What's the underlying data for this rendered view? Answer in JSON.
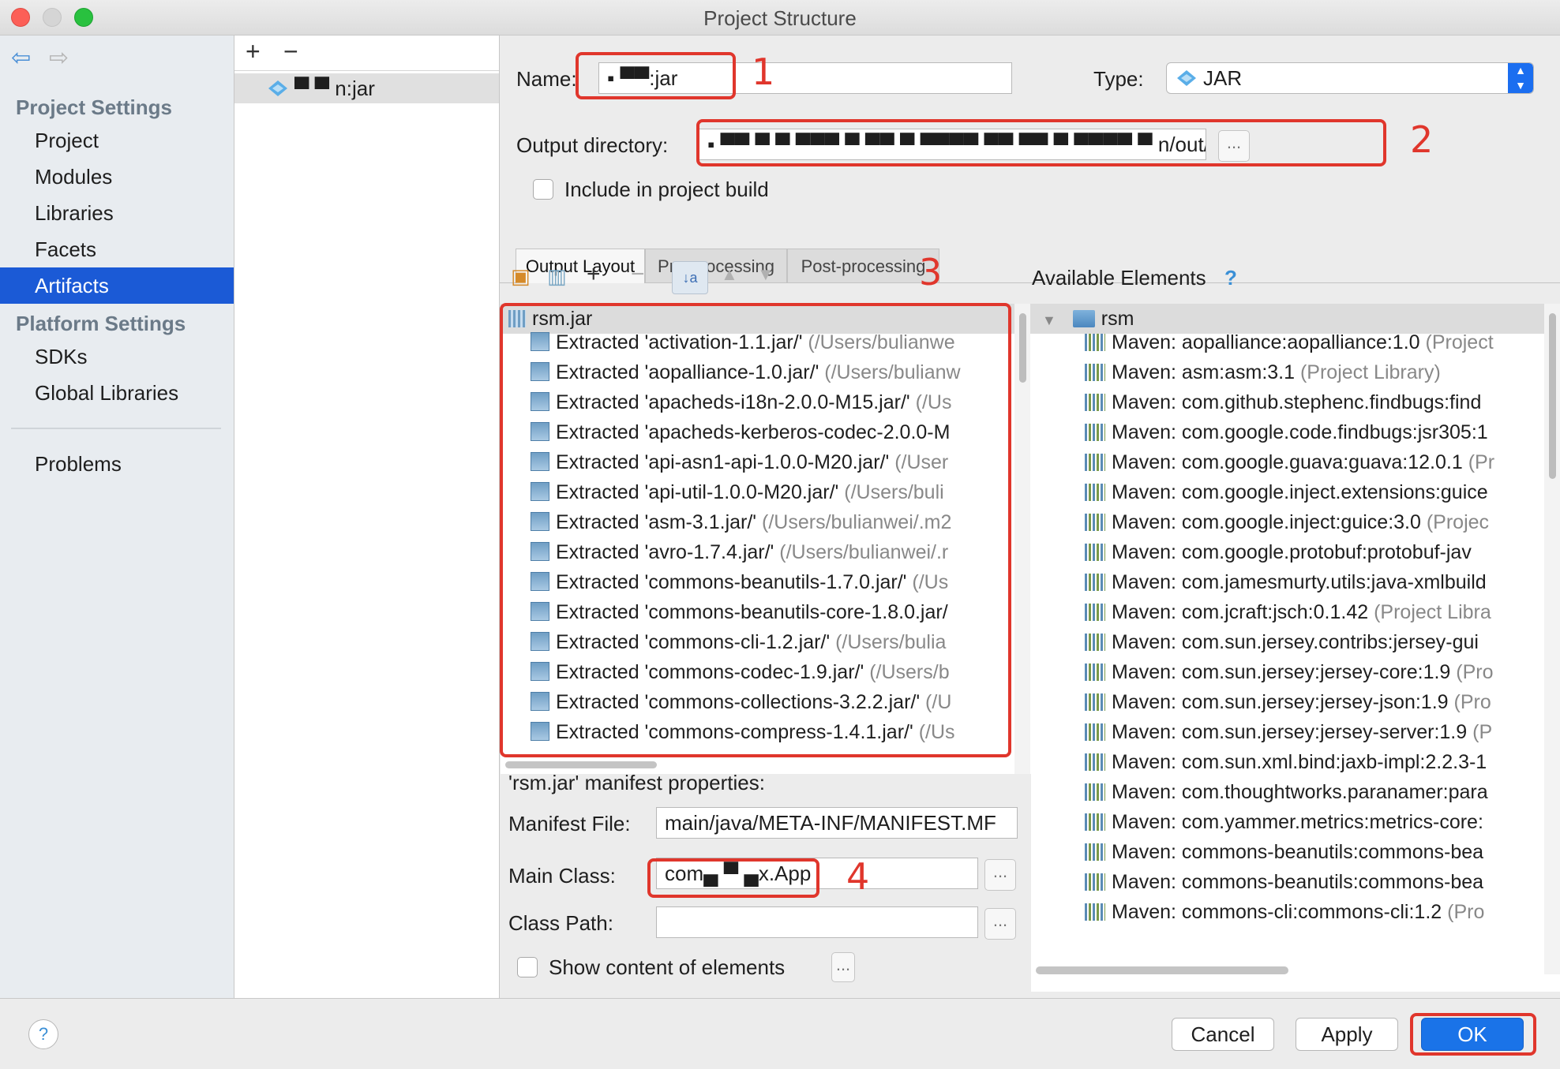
{
  "window": {
    "title": "Project Structure"
  },
  "sidebar": {
    "project_settings_heading": "Project Settings",
    "items": [
      "Project",
      "Modules",
      "Libraries",
      "Facets",
      "Artifacts"
    ],
    "platform_settings_heading": "Platform Settings",
    "platform_items": [
      "SDKs",
      "Global Libraries"
    ],
    "problems": "Problems"
  },
  "artifact_list": {
    "add": "+",
    "remove": "−",
    "item": "▀ ▀ n:jar"
  },
  "form": {
    "name_label": "Name:",
    "name_value": "▪ ▀▀:jar",
    "type_label": "Type:",
    "type_value": "JAR",
    "output_label": "Output directory:",
    "output_value": "▪ ▀▀ ▀ ▀ ▀▀▀ ▀ ▀▀ ▀ ▀▀▀▀ ▀▀ ▀▀ ▀ ▀▀▀▀ ▀ n/out/artifacts▀ ▀ ▀n_jar",
    "include_label": "Include in project build",
    "ellipsis": "..."
  },
  "tabs": [
    "Output Layout",
    "Pre-processing",
    "Post-processing"
  ],
  "available_label": "Available Elements",
  "help_mark": "?",
  "layout_tree": {
    "root": "rsm.jar",
    "rows": [
      {
        "t": "Extracted 'activation-1.1.jar/'",
        "h": " (/Users/bulianwe"
      },
      {
        "t": "Extracted 'aopalliance-1.0.jar/'",
        "h": " (/Users/bulianw"
      },
      {
        "t": "Extracted 'apacheds-i18n-2.0.0-M15.jar/'",
        "h": " (/Us"
      },
      {
        "t": "Extracted 'apacheds-kerberos-codec-2.0.0-M",
        "h": ""
      },
      {
        "t": "Extracted 'api-asn1-api-1.0.0-M20.jar/'",
        "h": " (/User"
      },
      {
        "t": "Extracted 'api-util-1.0.0-M20.jar/'",
        "h": " (/Users/buli"
      },
      {
        "t": "Extracted 'asm-3.1.jar/'",
        "h": " (/Users/bulianwei/.m2"
      },
      {
        "t": "Extracted 'avro-1.7.4.jar/'",
        "h": " (/Users/bulianwei/.r"
      },
      {
        "t": "Extracted 'commons-beanutils-1.7.0.jar/'",
        "h": " (/Us"
      },
      {
        "t": "Extracted 'commons-beanutils-core-1.8.0.jar/",
        "h": ""
      },
      {
        "t": "Extracted 'commons-cli-1.2.jar/'",
        "h": " (/Users/bulia"
      },
      {
        "t": "Extracted 'commons-codec-1.9.jar/'",
        "h": " (/Users/b"
      },
      {
        "t": "Extracted 'commons-collections-3.2.2.jar/'",
        "h": " (/U"
      },
      {
        "t": "Extracted 'commons-compress-1.4.1.jar/'",
        "h": " (/Us"
      }
    ]
  },
  "available_tree": {
    "root": "rsm",
    "rows": [
      {
        "t": "Maven: aopalliance:aopalliance:1.0",
        "h": " (Project"
      },
      {
        "t": "Maven: asm:asm:3.1",
        "h": " (Project Library)"
      },
      {
        "t": "Maven: com.github.stephenc.findbugs:find",
        "h": ""
      },
      {
        "t": "Maven: com.google.code.findbugs:jsr305:1",
        "h": ""
      },
      {
        "t": "Maven: com.google.guava:guava:12.0.1",
        "h": " (Pr"
      },
      {
        "t": "Maven: com.google.inject.extensions:guice",
        "h": ""
      },
      {
        "t": "Maven: com.google.inject:guice:3.0",
        "h": " (Projec"
      },
      {
        "t": "Maven: com.google.protobuf:protobuf-jav",
        "h": ""
      },
      {
        "t": "Maven: com.jamesmurty.utils:java-xmlbuild",
        "h": ""
      },
      {
        "t": "Maven: com.jcraft:jsch:0.1.42",
        "h": " (Project Libra"
      },
      {
        "t": "Maven: com.sun.jersey.contribs:jersey-gui",
        "h": ""
      },
      {
        "t": "Maven: com.sun.jersey:jersey-core:1.9",
        "h": " (Pro"
      },
      {
        "t": "Maven: com.sun.jersey:jersey-json:1.9",
        "h": " (Pro"
      },
      {
        "t": "Maven: com.sun.jersey:jersey-server:1.9",
        "h": " (P"
      },
      {
        "t": "Maven: com.sun.xml.bind:jaxb-impl:2.2.3-1",
        "h": ""
      },
      {
        "t": "Maven: com.thoughtworks.paranamer:para",
        "h": ""
      },
      {
        "t": "Maven: com.yammer.metrics:metrics-core:",
        "h": ""
      },
      {
        "t": "Maven: commons-beanutils:commons-bea",
        "h": ""
      },
      {
        "t": "Maven: commons-beanutils:commons-bea",
        "h": ""
      },
      {
        "t": "Maven: commons-cli:commons-cli:1.2",
        "h": " (Pro"
      }
    ]
  },
  "manifest": {
    "heading": "'rsm.jar' manifest properties:",
    "file_label": "Manifest File:",
    "file_value": "main/java/META-INF/MANIFEST.MF",
    "main_label": "Main Class:",
    "main_value": "com▄ ▀ ▄x.App",
    "cp_label": "Class Path:",
    "cp_value": "",
    "show_label": "Show content of elements"
  },
  "annotations": [
    "1",
    "2",
    "3",
    "4"
  ],
  "footer": {
    "help": "?",
    "cancel": "Cancel",
    "apply": "Apply",
    "ok": "OK"
  },
  "colors": {
    "selection": "#1b5ad6",
    "annotation": "#e0362c",
    "ok_button": "#1a73e8"
  }
}
